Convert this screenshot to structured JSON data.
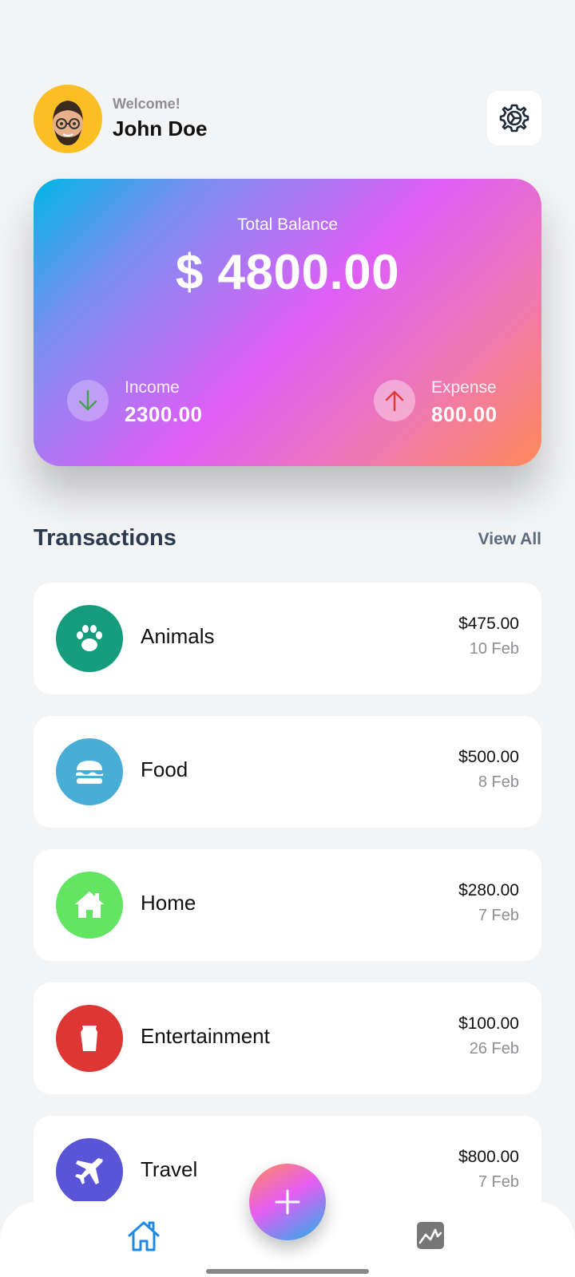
{
  "user": {
    "greeting": "Welcome!",
    "name": "John Doe"
  },
  "balance_card": {
    "label": "Total Balance",
    "amount": "$ 4800.00",
    "income": {
      "label": "Income",
      "value": "2300.00"
    },
    "expense": {
      "label": "Expense",
      "value": "800.00"
    }
  },
  "transactions": {
    "title": "Transactions",
    "view_all": "View All",
    "items": [
      {
        "name": "Animals",
        "amount": "$475.00",
        "date": "10 Feb",
        "icon": "paw-icon",
        "color": "#149c7c"
      },
      {
        "name": "Food",
        "amount": "$500.00",
        "date": "8 Feb",
        "icon": "burger-icon",
        "color": "#48aed6"
      },
      {
        "name": "Home",
        "amount": "$280.00",
        "date": "7 Feb",
        "icon": "house-icon",
        "color": "#63e563"
      },
      {
        "name": "Entertainment",
        "amount": "$100.00",
        "date": "26 Feb",
        "icon": "ticket-icon",
        "color": "#de3535"
      },
      {
        "name": "Travel",
        "amount": "$800.00",
        "date": "7 Feb",
        "icon": "airplane-icon",
        "color": "#5a55d6"
      }
    ]
  },
  "nav": {
    "home_icon": "home-icon",
    "stats_icon": "chart-icon",
    "add_icon": "plus-icon"
  },
  "colors": {
    "background": "#f3f4f6",
    "active_nav": "#1e88e5",
    "inactive_nav": "#777777"
  }
}
